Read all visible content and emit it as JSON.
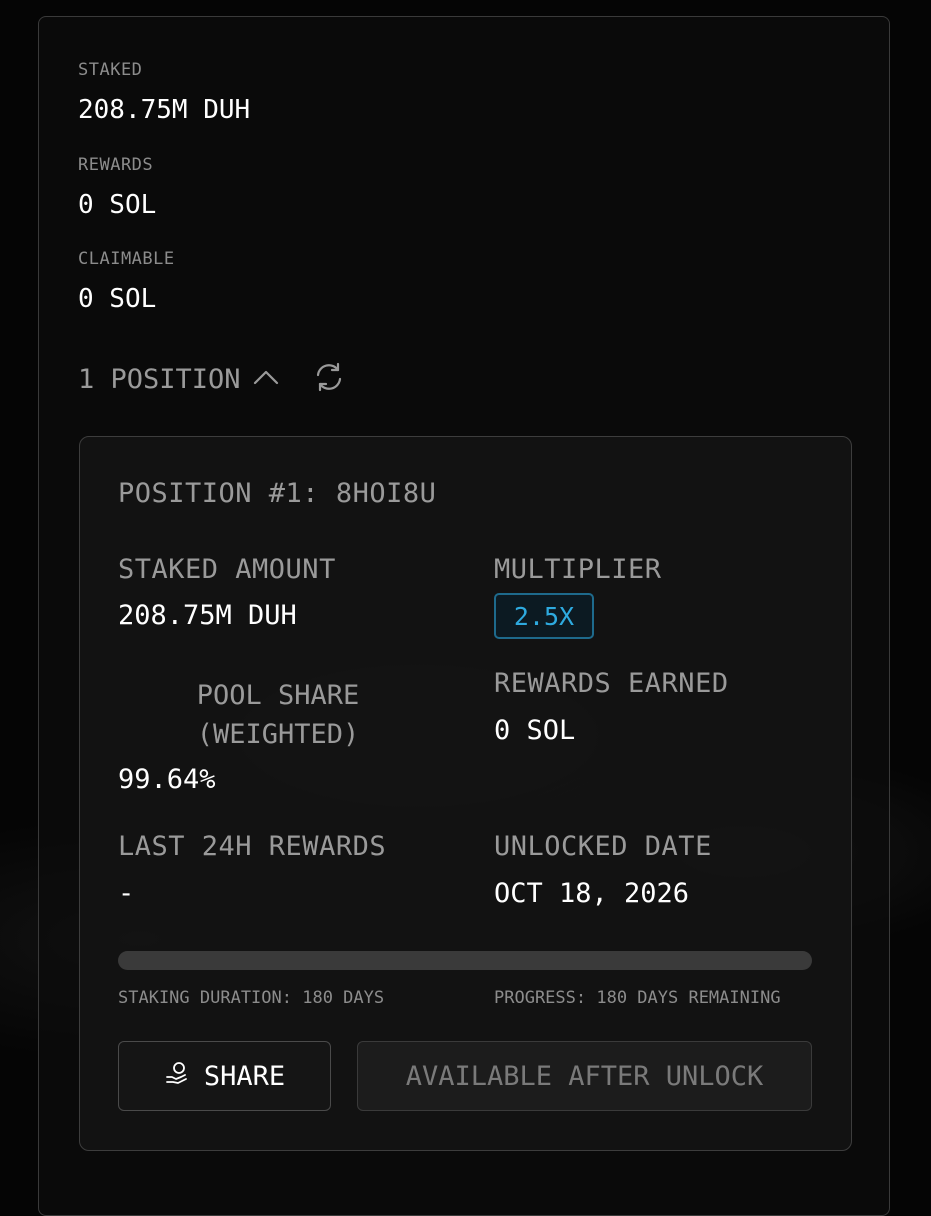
{
  "summary": {
    "staked_label": "STAKED",
    "staked_value": "208.75M DUH",
    "rewards_label": "REWARDS",
    "rewards_value": "0 SOL",
    "claimable_label": "CLAIMABLE",
    "claimable_value": "0 SOL"
  },
  "positions_header": {
    "label": "1 POSITION",
    "toggle_icon": "chevron-up-icon",
    "refresh_icon": "refresh-icon"
  },
  "position": {
    "title": "POSITION #1: 8HOI8U",
    "staked_amount_label": "STAKED AMOUNT",
    "staked_amount_value": "208.75M DUH",
    "multiplier_label": "MULTIPLIER",
    "multiplier_value": "2.5X",
    "pool_share_label_line1": "POOL SHARE",
    "pool_share_label_line2": "(WEIGHTED)",
    "pool_share_value": "99.64%",
    "rewards_earned_label": "REWARDS EARNED",
    "rewards_earned_value": "0 SOL",
    "last24h_label": "LAST 24H REWARDS",
    "last24h_value": "-",
    "unlocked_date_label": "UNLOCKED DATE",
    "unlocked_date_value": "OCT 18, 2026",
    "progress_fraction": 0,
    "staking_duration_text": "STAKING DURATION: 180 DAYS",
    "progress_text": "PROGRESS: 180 DAYS REMAINING",
    "share_button_label": "SHARE",
    "share_icon": "coins-hand-icon",
    "unlock_button_label": "AVAILABLE AFTER UNLOCK"
  },
  "colors": {
    "accent_blue": "#2eaadf",
    "badge_border": "#1e6a8c"
  }
}
